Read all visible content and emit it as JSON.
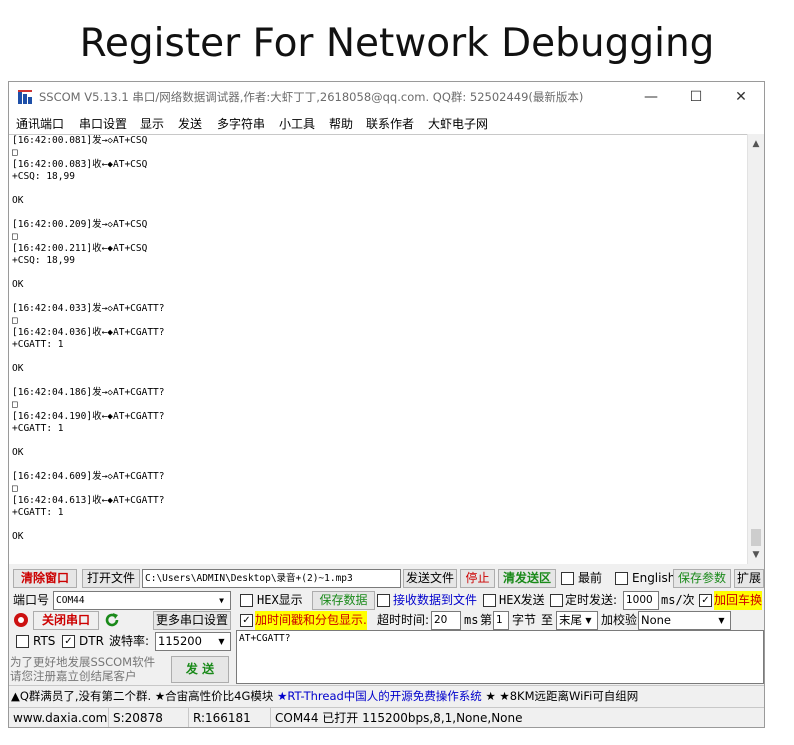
{
  "heading": "Register For Network Debugging",
  "window": {
    "title": "SSCOM V5.13.1 串口/网络数据调试器,作者:大虾丁丁,2618058@qq.com. QQ群: 52502449(最新版本)",
    "minimize": "—",
    "maximize": "☐",
    "close": "✕"
  },
  "menu": [
    "通讯端口",
    "串口设置",
    "显示",
    "发送",
    "多字符串",
    "小工具",
    "帮助",
    "联系作者",
    "大虾电子网"
  ],
  "receive_lines": [
    "[16:42:00.081]发→◇AT+CSQ",
    "□",
    "[16:42:00.083]收←◆AT+CSQ",
    "+CSQ: 18,99",
    "",
    "OK",
    "",
    "[16:42:00.209]发→◇AT+CSQ",
    "□",
    "[16:42:00.211]收←◆AT+CSQ",
    "+CSQ: 18,99",
    "",
    "OK",
    "",
    "[16:42:04.033]发→◇AT+CGATT?",
    "□",
    "[16:42:04.036]收←◆AT+CGATT?",
    "+CGATT: 1",
    "",
    "OK",
    "",
    "[16:42:04.186]发→◇AT+CGATT?",
    "□",
    "[16:42:04.190]收←◆AT+CGATT?",
    "+CGATT: 1",
    "",
    "OK",
    "",
    "[16:42:04.609]发→◇AT+CGATT?",
    "□",
    "[16:42:04.613]收←◆AT+CGATT?",
    "+CGATT: 1",
    "",
    "OK"
  ],
  "toolbar": {
    "clear_window": "清除窗口",
    "open_file": "打开文件",
    "file_path": "C:\\Users\\ADMIN\\Desktop\\录音+(2)~1.mp3",
    "send_file": "发送文件",
    "stop": "停止",
    "clear_send": "清发送区",
    "topmost": "最前",
    "english": "English",
    "save_params": "保存参数",
    "expand": "扩展"
  },
  "port": {
    "port_label": "端口号",
    "port_value": "COM44",
    "close_port": "关闭串口",
    "more_settings": "更多串口设置",
    "rts": "RTS",
    "dtr": "DTR",
    "baud_label": "波特率:",
    "baud_value": "115200"
  },
  "options": {
    "hex_display": "HEX显示",
    "save_data": "保存数据",
    "recv_to_file": "接收数据到文件",
    "hex_send": "HEX发送",
    "timed_send": "定时发送:",
    "interval": "1000",
    "interval_unit": "ms/次",
    "add_crlf": "加回车换",
    "timestamp": "加时间戳和分包显示.",
    "timeout_label": "超时时间:",
    "timeout_value": "20",
    "timeout_unit": "ms",
    "nth_label": "第",
    "nth_value": "1",
    "byte_label": "字节",
    "to_label": "至",
    "end_value": "末尾",
    "checksum_label": "加校验",
    "checksum_value": "None"
  },
  "send": {
    "text": "AT+CGATT?",
    "send_button": "发 送",
    "promo": "为了更好地发展SSCOM软件\n请您注册嘉立创结尾客户"
  },
  "ad": {
    "part1": "▲Q群满员了,没有第二个群. ★合宙高性价比4G模块 ",
    "part2": "★RT-Thread中国人的开源免费操作系统",
    "part3": " ★ ★8KM远距离WiFi可自组网"
  },
  "status": {
    "site": "www.daxia.com",
    "sent": "S:20878",
    "received": "R:166181",
    "port_state": "COM44 已打开  115200bps,8,1,None,None"
  }
}
